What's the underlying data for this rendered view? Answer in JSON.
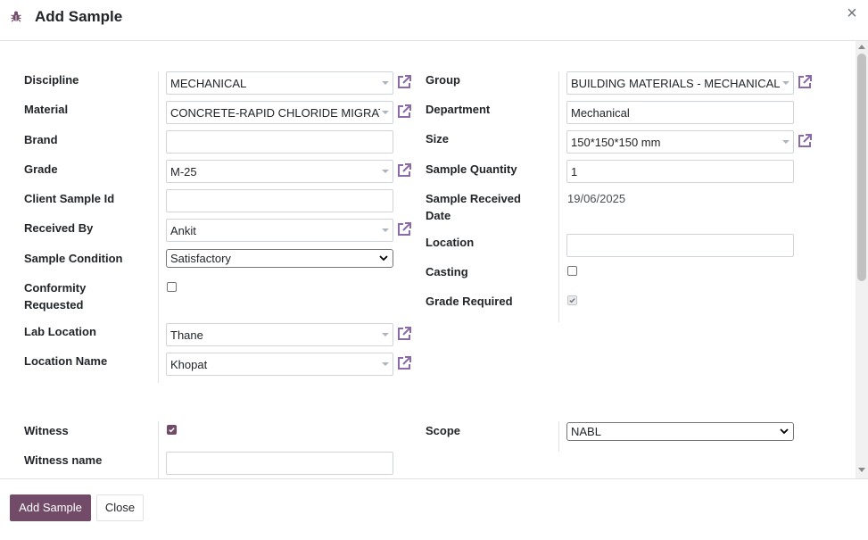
{
  "dialog": {
    "title": "Add Sample",
    "close_symbol": "×",
    "icon": "bug-icon"
  },
  "colors": {
    "brand": "#714b67",
    "link_icon": "#8a6aa8"
  },
  "form": {
    "left": {
      "discipline": {
        "label": "Discipline",
        "value": "MECHANICAL"
      },
      "material": {
        "label": "Material",
        "value": "CONCRETE-RAPID CHLORIDE MIGRATION"
      },
      "brand": {
        "label": "Brand",
        "value": ""
      },
      "grade": {
        "label": "Grade",
        "value": "M-25"
      },
      "client_sample_id": {
        "label": "Client Sample Id",
        "value": ""
      },
      "received_by": {
        "label": "Received By",
        "value": "Ankit"
      },
      "sample_condition": {
        "label": "Sample Condition",
        "value": "Satisfactory"
      },
      "conformity_requested": {
        "label_line1": "Conformity",
        "label_line2": "Requested",
        "checked": false
      },
      "lab_location": {
        "label": "Lab Location",
        "value": "Thane"
      },
      "location_name": {
        "label": "Location Name",
        "value": "Khopat"
      }
    },
    "right": {
      "group": {
        "label": "Group",
        "value": "BUILDING MATERIALS - MECHANICAL"
      },
      "department": {
        "label": "Department",
        "value": "Mechanical"
      },
      "size": {
        "label": "Size",
        "value": "150*150*150 mm"
      },
      "sample_quantity": {
        "label": "Sample Quantity",
        "value": "1"
      },
      "sample_received_date": {
        "label_line1": "Sample Received",
        "label_line2": "Date",
        "value": "19/06/2025"
      },
      "location": {
        "label": "Location",
        "value": ""
      },
      "casting": {
        "label": "Casting",
        "checked": false
      },
      "grade_required": {
        "label": "Grade Required",
        "checked": true
      }
    },
    "bottom": {
      "witness": {
        "label": "Witness",
        "checked": true
      },
      "witness_name": {
        "label": "Witness name",
        "value": ""
      },
      "scope": {
        "label": "Scope",
        "value": "NABL"
      }
    }
  },
  "footer": {
    "add_label": "Add Sample",
    "close_label": "Close"
  }
}
